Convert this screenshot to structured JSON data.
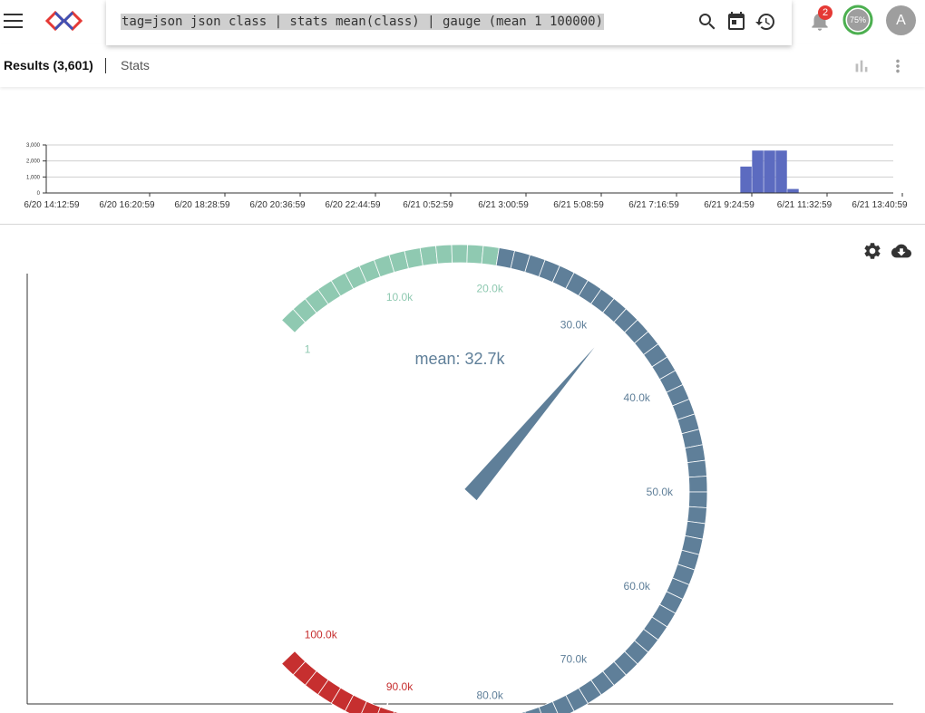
{
  "search": {
    "query": "tag=json json class | stats mean(class) | gauge (mean 1 100000)"
  },
  "icons": {
    "menu": "menu-icon",
    "logo": "app-logo",
    "search": "search-icon",
    "calendar": "calendar-icon",
    "history": "history-icon",
    "notifications": "bell-icon",
    "chart": "bar-chart-icon",
    "more": "more-vert-icon",
    "settings": "gear-icon",
    "download": "cloud-download-icon"
  },
  "notifications": {
    "count": "2"
  },
  "progress": {
    "label": "75%",
    "value": 0.75
  },
  "user": {
    "initial": "A"
  },
  "tabs": {
    "results": "Results (3,601)",
    "stats": "Stats"
  },
  "histogram": {
    "y_ticks": [
      "0",
      "1,000",
      "2,000",
      "3,000"
    ],
    "y_max": 3000,
    "x_labels": [
      "6/20 14:12:59",
      "6/20 16:20:59",
      "6/20 18:28:59",
      "6/20 20:36:59",
      "6/20 22:44:59",
      "6/21 0:52:59",
      "6/21 3:00:59",
      "6/21 5:08:59",
      "6/21 7:16:59",
      "6/21 9:24:59",
      "6/21 11:32:59",
      "6/21 13:40:59"
    ],
    "bars": [
      {
        "bin": 59,
        "value": 1650
      },
      {
        "bin": 60,
        "value": 2650
      },
      {
        "bin": 61,
        "value": 2650
      },
      {
        "bin": 62,
        "value": 2650
      },
      {
        "bin": 63,
        "value": 250
      }
    ],
    "bin_count": 72,
    "bar_color": "#5c6bc0"
  },
  "chart_data": {
    "type": "gauge",
    "min": 1,
    "max": 100000,
    "value": 32700,
    "label": "mean: 32.7k",
    "ticks": [
      {
        "value": 1,
        "label": "1"
      },
      {
        "value": 10000,
        "label": "10.0k"
      },
      {
        "value": 20000,
        "label": "20.0k"
      },
      {
        "value": 30000,
        "label": "30.0k"
      },
      {
        "value": 40000,
        "label": "40.0k"
      },
      {
        "value": 50000,
        "label": "50.0k"
      },
      {
        "value": 60000,
        "label": "60.0k"
      },
      {
        "value": 70000,
        "label": "70.0k"
      },
      {
        "value": 80000,
        "label": "80.0k"
      },
      {
        "value": 90000,
        "label": "90.0k"
      },
      {
        "value": 100000,
        "label": "100.0k"
      }
    ],
    "bands": [
      {
        "from": 1,
        "to": 20000,
        "color": "#8fc9b1"
      },
      {
        "from": 20000,
        "to": 80000,
        "color": "#5f7f99"
      },
      {
        "from": 80000,
        "to": 100000,
        "color": "#c62f2f"
      }
    ]
  }
}
